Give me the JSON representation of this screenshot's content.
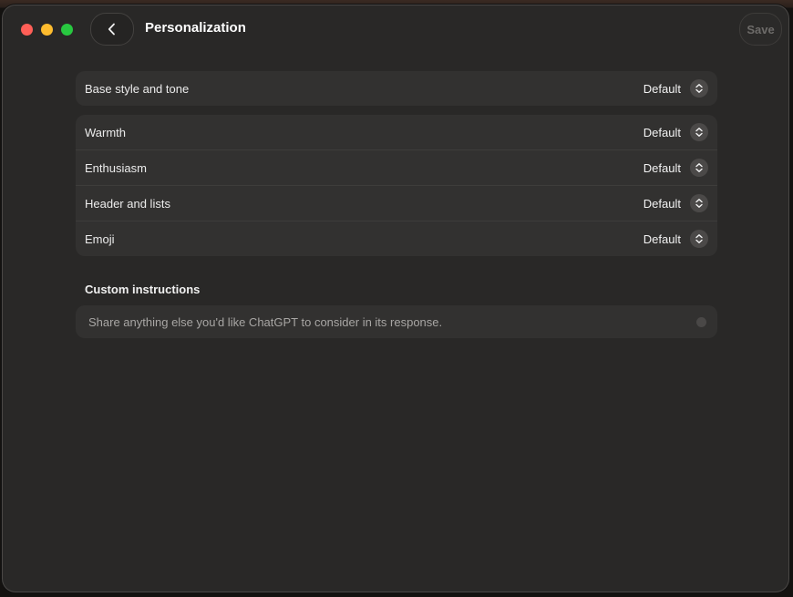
{
  "header": {
    "title": "Personalization",
    "save_label": "Save"
  },
  "base_style": {
    "label": "Base style and tone",
    "value": "Default"
  },
  "characteristics": [
    {
      "label": "Warmth",
      "value": "Default"
    },
    {
      "label": "Enthusiasm",
      "value": "Default"
    },
    {
      "label": "Header and lists",
      "value": "Default"
    },
    {
      "label": "Emoji",
      "value": "Default"
    }
  ],
  "custom_instructions": {
    "heading": "Custom instructions",
    "placeholder": "Share anything else you'd like ChatGPT to consider in its response.",
    "value": ""
  },
  "colors": {
    "close": "#ff5f57",
    "minimize": "#febc2e",
    "maximize": "#28c840",
    "window_bg": "#292827",
    "card_bg": "#323130"
  },
  "icons": {
    "back": "chevron-left-icon",
    "stepper": "up-down-chevron-icon"
  }
}
